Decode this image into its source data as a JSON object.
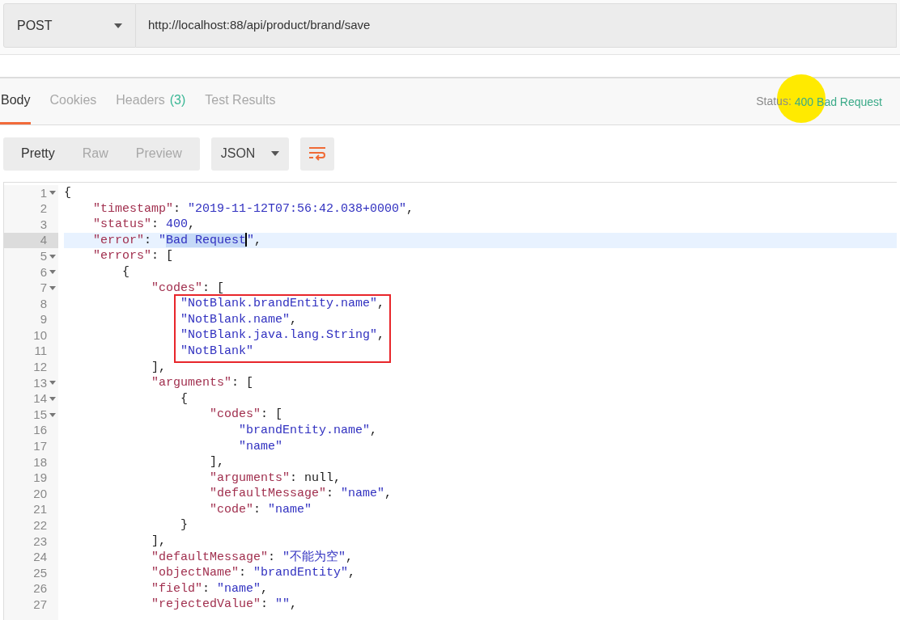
{
  "request": {
    "method": "POST",
    "url": "http://localhost:88/api/product/brand/save"
  },
  "response_tabs": [
    {
      "label": "Body",
      "selected": true
    },
    {
      "label": "Cookies",
      "selected": false
    },
    {
      "label": "Headers",
      "count": "(3)",
      "selected": false
    },
    {
      "label": "Test Results",
      "selected": false
    }
  ],
  "status": {
    "label": "Status:",
    "value": "400 Bad Request"
  },
  "view_modes": [
    {
      "label": "Pretty",
      "selected": true
    },
    {
      "label": "Raw",
      "selected": false
    },
    {
      "label": "Preview",
      "selected": false
    }
  ],
  "format": "JSON",
  "code_lines": [
    {
      "number": "1",
      "foldable": true,
      "tokens": [
        {
          "kind": "punct",
          "text": "{"
        }
      ]
    },
    {
      "number": "2",
      "foldable": false,
      "tokens": [
        {
          "kind": "key",
          "text": "    \"timestamp\""
        },
        {
          "kind": "punct",
          "text": ": "
        },
        {
          "kind": "string",
          "text": "\"2019-11-12T07:56:42.038+0000\""
        },
        {
          "kind": "punct",
          "text": ","
        }
      ]
    },
    {
      "number": "3",
      "foldable": false,
      "tokens": [
        {
          "kind": "key",
          "text": "    \"status\""
        },
        {
          "kind": "punct",
          "text": ": "
        },
        {
          "kind": "number",
          "text": "400"
        },
        {
          "kind": "punct",
          "text": ","
        }
      ]
    },
    {
      "number": "4",
      "foldable": false,
      "current": true,
      "tokens": [
        {
          "kind": "key",
          "text": "    \"error\""
        },
        {
          "kind": "punct",
          "text": ": "
        },
        {
          "kind": "string",
          "text": "\""
        },
        {
          "kind": "string",
          "text": "Bad Request",
          "selected": true
        },
        {
          "kind": "string",
          "text": "\""
        },
        {
          "kind": "punct",
          "text": ","
        }
      ]
    },
    {
      "number": "5",
      "foldable": true,
      "tokens": [
        {
          "kind": "key",
          "text": "    \"errors\""
        },
        {
          "kind": "punct",
          "text": ": ["
        }
      ]
    },
    {
      "number": "6",
      "foldable": true,
      "tokens": [
        {
          "kind": "punct",
          "text": "        {"
        }
      ]
    },
    {
      "number": "7",
      "foldable": true,
      "tokens": [
        {
          "kind": "key",
          "text": "            \"codes\""
        },
        {
          "kind": "punct",
          "text": ": ["
        }
      ]
    },
    {
      "number": "8",
      "foldable": false,
      "boxed": true,
      "tokens": [
        {
          "kind": "string",
          "text": "                \"NotBlank.brandEntity.name\""
        },
        {
          "kind": "punct",
          "text": ","
        }
      ]
    },
    {
      "number": "9",
      "foldable": false,
      "boxed": true,
      "tokens": [
        {
          "kind": "string",
          "text": "                \"NotBlank.name\""
        },
        {
          "kind": "punct",
          "text": ","
        }
      ]
    },
    {
      "number": "10",
      "foldable": false,
      "boxed": true,
      "tokens": [
        {
          "kind": "string",
          "text": "                \"NotBlank.java.lang.String\""
        },
        {
          "kind": "punct",
          "text": ","
        }
      ]
    },
    {
      "number": "11",
      "foldable": false,
      "boxed": true,
      "tokens": [
        {
          "kind": "string",
          "text": "                \"NotBlank\""
        }
      ]
    },
    {
      "number": "12",
      "foldable": false,
      "tokens": [
        {
          "kind": "punct",
          "text": "            ],"
        }
      ]
    },
    {
      "number": "13",
      "foldable": true,
      "tokens": [
        {
          "kind": "key",
          "text": "            \"arguments\""
        },
        {
          "kind": "punct",
          "text": ": ["
        }
      ]
    },
    {
      "number": "14",
      "foldable": true,
      "tokens": [
        {
          "kind": "punct",
          "text": "                {"
        }
      ]
    },
    {
      "number": "15",
      "foldable": true,
      "tokens": [
        {
          "kind": "key",
          "text": "                    \"codes\""
        },
        {
          "kind": "punct",
          "text": ": ["
        }
      ]
    },
    {
      "number": "16",
      "foldable": false,
      "tokens": [
        {
          "kind": "string",
          "text": "                        \"brandEntity.name\""
        },
        {
          "kind": "punct",
          "text": ","
        }
      ]
    },
    {
      "number": "17",
      "foldable": false,
      "tokens": [
        {
          "kind": "string",
          "text": "                        \"name\""
        }
      ]
    },
    {
      "number": "18",
      "foldable": false,
      "tokens": [
        {
          "kind": "punct",
          "text": "                    ],"
        }
      ]
    },
    {
      "number": "19",
      "foldable": false,
      "tokens": [
        {
          "kind": "key",
          "text": "                    \"arguments\""
        },
        {
          "kind": "punct",
          "text": ": null,"
        }
      ]
    },
    {
      "number": "20",
      "foldable": false,
      "tokens": [
        {
          "kind": "key",
          "text": "                    \"defaultMessage\""
        },
        {
          "kind": "punct",
          "text": ": "
        },
        {
          "kind": "string",
          "text": "\"name\""
        },
        {
          "kind": "punct",
          "text": ","
        }
      ]
    },
    {
      "number": "21",
      "foldable": false,
      "tokens": [
        {
          "kind": "key",
          "text": "                    \"code\""
        },
        {
          "kind": "punct",
          "text": ": "
        },
        {
          "kind": "string",
          "text": "\"name\""
        }
      ]
    },
    {
      "number": "22",
      "foldable": false,
      "tokens": [
        {
          "kind": "punct",
          "text": "                }"
        }
      ]
    },
    {
      "number": "23",
      "foldable": false,
      "tokens": [
        {
          "kind": "punct",
          "text": "            ],"
        }
      ]
    },
    {
      "number": "24",
      "foldable": false,
      "tokens": [
        {
          "kind": "key",
          "text": "            \"defaultMessage\""
        },
        {
          "kind": "punct",
          "text": ": "
        },
        {
          "kind": "string",
          "text": "\"不能为空\""
        },
        {
          "kind": "punct",
          "text": ","
        }
      ]
    },
    {
      "number": "25",
      "foldable": false,
      "tokens": [
        {
          "kind": "key",
          "text": "            \"objectName\""
        },
        {
          "kind": "punct",
          "text": ": "
        },
        {
          "kind": "string",
          "text": "\"brandEntity\""
        },
        {
          "kind": "punct",
          "text": ","
        }
      ]
    },
    {
      "number": "26",
      "foldable": false,
      "tokens": [
        {
          "kind": "key",
          "text": "            \"field\""
        },
        {
          "kind": "punct",
          "text": ": "
        },
        {
          "kind": "string",
          "text": "\"name\""
        },
        {
          "kind": "punct",
          "text": ","
        }
      ]
    },
    {
      "number": "27",
      "foldable": false,
      "tokens": [
        {
          "kind": "key",
          "text": "            \"rejectedValue\""
        },
        {
          "kind": "punct",
          "text": ": "
        },
        {
          "kind": "string",
          "text": "\"\""
        },
        {
          "kind": "punct",
          "text": ","
        }
      ]
    }
  ]
}
